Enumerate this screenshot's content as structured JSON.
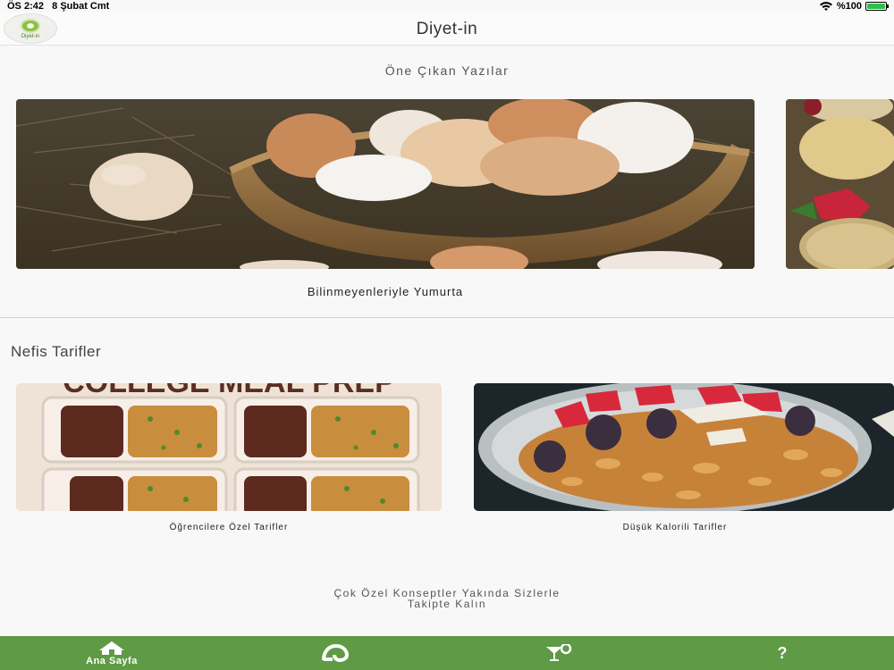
{
  "status_bar": {
    "time": "ÖS 2:42",
    "date": "8 Şubat Cmt",
    "battery": "%100",
    "battery_level": 1.0
  },
  "nav": {
    "title": "Diyet-in",
    "logo_text": "Diyet-in"
  },
  "featured": {
    "heading": "Öne Çıkan Yazılar",
    "items": [
      {
        "caption": "Bilinmeyenleriyle Yumurta"
      }
    ]
  },
  "recipes": {
    "heading": "Nefis Tarifler",
    "items": [
      {
        "caption": "Öğrencilere Özel Tarifler",
        "image_text": "COLLEGE MEAL PREP"
      },
      {
        "caption": "Düşük Kalorili Tarifler"
      }
    ]
  },
  "coming_soon": {
    "line1": "Çok Özel Konseptler Yakında Sizlerle",
    "line2": "Takipte Kalın"
  },
  "tab_bar": {
    "items": [
      {
        "label": "Ana Sayfa",
        "icon": "home-icon"
      },
      {
        "label": "",
        "icon": "measure-tape-icon"
      },
      {
        "label": "",
        "icon": "cocktail-icon"
      },
      {
        "label": "",
        "icon": "question-icon"
      }
    ]
  },
  "colors": {
    "tab_bar": "#5f9a45",
    "background": "#f8f8f8",
    "logo_green": "#8cc04a"
  }
}
